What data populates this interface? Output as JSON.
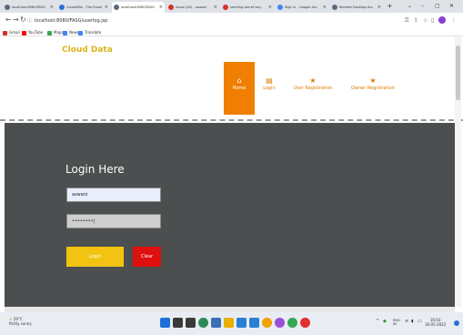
{
  "browser": {
    "tabs": [
      {
        "title": "localhost:8080/FASG",
        "color": "#5a6b7d",
        "active": false
      },
      {
        "title": "Cloud4Mo - The Exam",
        "color": "#2a6fd6",
        "active": false
      },
      {
        "title": "localhost:8080/FASG",
        "color": "#5a6b7d",
        "active": true
      },
      {
        "title": "Inbox (44) - aswani",
        "color": "#d93025",
        "active": false
      },
      {
        "title": "sending secret key -",
        "color": "#d93025",
        "active": false
      },
      {
        "title": "Sign in - Google Acc",
        "color": "#4285f4",
        "active": false
      },
      {
        "title": "Remote Desktop Acc",
        "color": "#5a6b7d",
        "active": false
      }
    ],
    "new_tab": "+",
    "window_controls": [
      "⌄",
      "–",
      "▢",
      "✕"
    ],
    "url": "localhost:8080/FASG/userlog.jsp",
    "bookmarks": [
      {
        "label": "Gmail",
        "color": "#d93025"
      },
      {
        "label": "YouTube",
        "color": "#ff0000"
      },
      {
        "label": "Maps",
        "color": "#34a853"
      },
      {
        "label": "News",
        "color": "#4285f4"
      },
      {
        "label": "Translate",
        "color": "#4285f4"
      }
    ]
  },
  "site": {
    "title": "Cloud Data",
    "nav": [
      {
        "label": "Home",
        "icon": "home-icon",
        "glyph": "⌂",
        "active": true
      },
      {
        "label": "Login",
        "icon": "document-icon",
        "glyph": "▤",
        "active": false
      },
      {
        "label": "User Registration",
        "icon": "star-icon",
        "glyph": "★",
        "active": false
      },
      {
        "label": "Owner Registration",
        "icon": "star-icon",
        "glyph": "★",
        "active": false
      }
    ]
  },
  "login": {
    "title": "Login Here",
    "username_value": "aswani",
    "password_value": "••••••••|",
    "login_label": "Login",
    "clear_label": "Clear"
  },
  "taskbar": {
    "weather_temp": "29°C",
    "weather_desc": "Partly sunny",
    "icons": [
      {
        "name": "start-icon",
        "color": "#1e6fd9"
      },
      {
        "name": "search-icon",
        "color": "#3a3a3a"
      },
      {
        "name": "task-view-icon",
        "color": "#3a3a3a"
      },
      {
        "name": "chrome-icon",
        "color": "#2e8b57"
      },
      {
        "name": "settings-icon",
        "color": "#3a6fb0"
      },
      {
        "name": "file-explorer-icon",
        "color": "#e8b000"
      },
      {
        "name": "store-icon",
        "color": "#2a7fd4"
      },
      {
        "name": "mail-icon",
        "color": "#2a7fd4"
      },
      {
        "name": "app-icon",
        "color": "#f0a000"
      },
      {
        "name": "app-icon-2",
        "color": "#9b4fd6"
      },
      {
        "name": "chrome-icon-2",
        "color": "#34a853"
      },
      {
        "name": "app-icon-3",
        "color": "#e03030"
      }
    ],
    "tray_lang": "ENG",
    "tray_region": "IN",
    "time": "16:03",
    "date": "16-05-2022"
  }
}
